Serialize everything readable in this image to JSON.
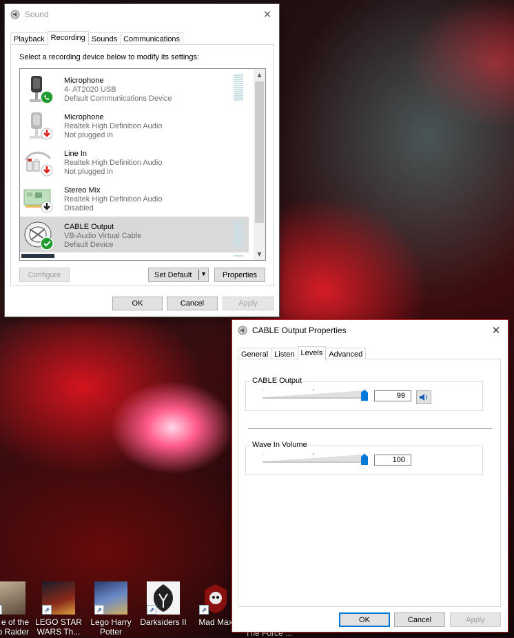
{
  "sound_dialog": {
    "title": "Sound",
    "tabs": [
      "Playback",
      "Recording",
      "Sounds",
      "Communications"
    ],
    "active_tab": "Recording",
    "instruction": "Select a recording device below to modify its settings:",
    "devices": [
      {
        "name": "Microphone",
        "driver": "4- AT2020 USB",
        "status": "Default Communications Device",
        "badge": "phone",
        "icon": "microphone-icon"
      },
      {
        "name": "Microphone",
        "driver": "Realtek High Definition Audio",
        "status": "Not plugged in",
        "badge": "red-down-arrow",
        "icon": "microphone-icon"
      },
      {
        "name": "Line In",
        "driver": "Realtek High Definition Audio",
        "status": "Not plugged in",
        "badge": "red-down-arrow",
        "icon": "rca-cable-icon"
      },
      {
        "name": "Stereo Mix",
        "driver": "Realtek High Definition Audio",
        "status": "Disabled",
        "badge": "black-down-arrow",
        "icon": "sound-card-icon"
      },
      {
        "name": "CABLE Output",
        "driver": "VB-Audio Virtual Cable",
        "status": "Default Device",
        "badge": "green-check",
        "icon": "virtual-cable-icon",
        "selected": true
      }
    ],
    "configure_label": "Configure",
    "set_default_label": "Set Default",
    "properties_label": "Properties",
    "ok_label": "OK",
    "cancel_label": "Cancel",
    "apply_label": "Apply"
  },
  "cable_dialog": {
    "title": "CABLE Output Properties",
    "tabs": [
      "General",
      "Listen",
      "Levels",
      "Advanced"
    ],
    "active_tab": "Levels",
    "level1": {
      "label": "CABLE Output",
      "value": "99",
      "level_percent": 99
    },
    "level2": {
      "label": "Wave In Volume",
      "value": "100",
      "level_percent": 100
    },
    "ok_label": "OK",
    "cancel_label": "Cancel",
    "apply_label": "Apply"
  },
  "desktop_icons": [
    {
      "label": "e of the\nb Raider",
      "icon": "tomb-raider-icon"
    },
    {
      "label": "LEGO STAR\nWARS Th...",
      "icon": "lego-star-wars-icon"
    },
    {
      "label": "Lego Harry\nPotter",
      "icon": "lego-harry-potter-icon"
    },
    {
      "label": "Darksiders II",
      "icon": "darksiders-icon"
    },
    {
      "label": "Mad Max",
      "icon": "mad-max-icon"
    }
  ],
  "partial_label": "The Force ...",
  "colors": {
    "accent": "#0078d7",
    "selection": "#d9d9d9",
    "green": "#1e9c2e",
    "red": "#e0201b"
  }
}
